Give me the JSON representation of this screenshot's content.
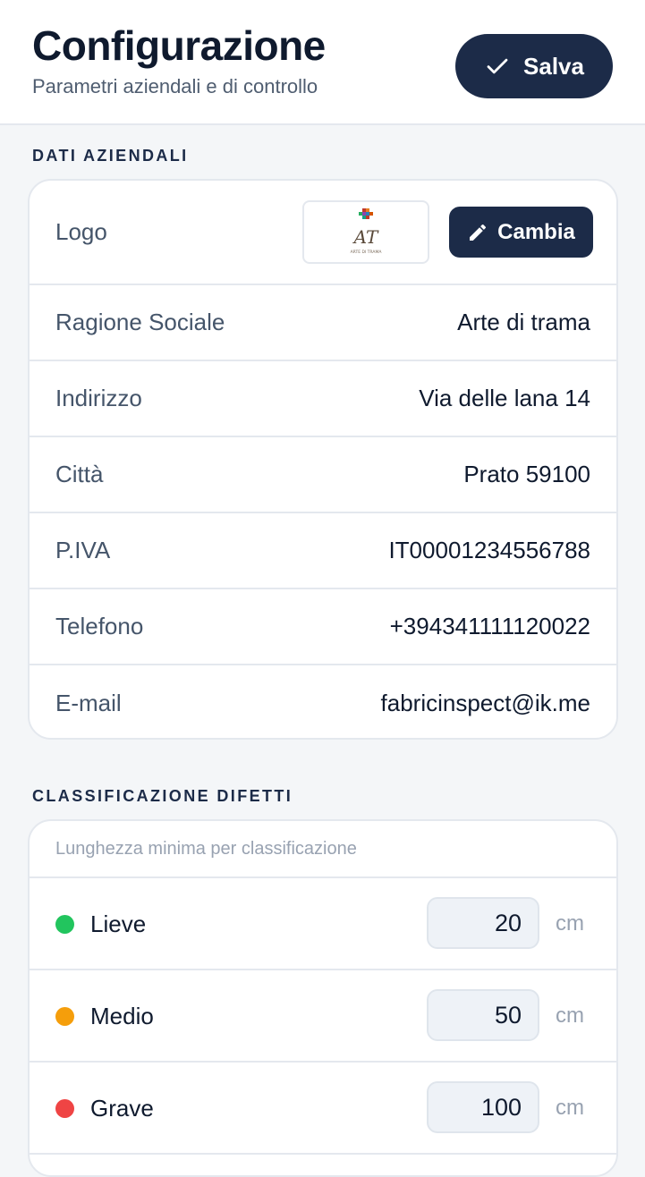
{
  "header": {
    "title": "Configurazione",
    "subtitle": "Parametri aziendali e di controllo",
    "save_label": "Salva"
  },
  "company": {
    "section_title": "DATI AZIENDALI",
    "logo_label": "Logo",
    "logo_monogram": "AT",
    "logo_caption": "ARTE DI TRAMA",
    "change_label": "Cambia",
    "fields": [
      {
        "label": "Ragione Sociale",
        "value": "Arte di trama"
      },
      {
        "label": "Indirizzo",
        "value": "Via delle lana 14"
      },
      {
        "label": "Città",
        "value": "Prato 59100"
      },
      {
        "label": "P.IVA",
        "value": "IT00001234556788"
      },
      {
        "label": "Telefono",
        "value": "+394341111120022"
      },
      {
        "label": "E-mail",
        "value": "fabricinspect@ik.me"
      }
    ]
  },
  "defects": {
    "section_title": "CLASSIFICAZIONE DIFETTI",
    "hint": "Lunghezza minima per classificazione",
    "levels": [
      {
        "name": "Lieve",
        "value": "20",
        "unit": "cm",
        "color": "#22c55e"
      },
      {
        "name": "Medio",
        "value": "50",
        "unit": "cm",
        "color": "#f59e0b"
      },
      {
        "name": "Grave",
        "value": "100",
        "unit": "cm",
        "color": "#ef4444"
      }
    ]
  }
}
